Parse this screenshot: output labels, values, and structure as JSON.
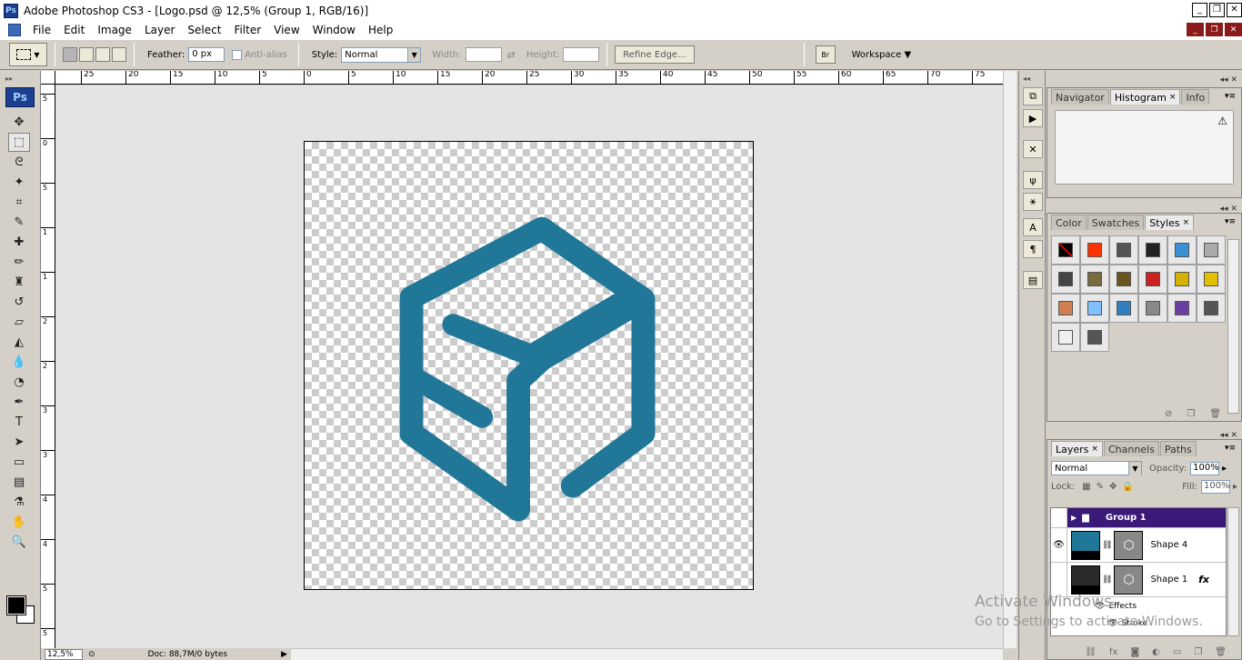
{
  "window": {
    "title": "Adobe Photoshop CS3 - [Logo.psd @ 12,5% (Group 1, RGB/16)]",
    "app_badge": "Ps",
    "controls": [
      "_",
      "❐",
      "✕"
    ],
    "doc_controls": [
      "_",
      "❐",
      "✕"
    ]
  },
  "menu": [
    "File",
    "Edit",
    "Image",
    "Layer",
    "Select",
    "Filter",
    "View",
    "Window",
    "Help"
  ],
  "options": {
    "feather_label": "Feather:",
    "feather_value": "0 px",
    "antialias_label": "Anti-alias",
    "style_label": "Style:",
    "style_value": "Normal",
    "width_label": "Width:",
    "height_label": "Height:",
    "refine_edge": "Refine Edge...",
    "bridge_label": "Br",
    "workspace_label": "Workspace"
  },
  "toolbox": {
    "logo": "Ps",
    "tools": [
      {
        "name": "move-tool",
        "glyph": "✥"
      },
      {
        "name": "rectangular-marquee-tool",
        "glyph": "⬚",
        "active": true
      },
      {
        "name": "lasso-tool",
        "glyph": "ᘓ"
      },
      {
        "name": "magic-wand-tool",
        "glyph": "✦"
      },
      {
        "name": "crop-tool",
        "glyph": "⌗"
      },
      {
        "name": "slice-tool",
        "glyph": "✎"
      },
      {
        "name": "healing-brush-tool",
        "glyph": "✚"
      },
      {
        "name": "brush-tool",
        "glyph": "✏"
      },
      {
        "name": "clone-stamp-tool",
        "glyph": "♜"
      },
      {
        "name": "history-brush-tool",
        "glyph": "↺"
      },
      {
        "name": "eraser-tool",
        "glyph": "▱"
      },
      {
        "name": "paint-bucket-tool",
        "glyph": "◭"
      },
      {
        "name": "blur-tool",
        "glyph": "💧"
      },
      {
        "name": "dodge-tool",
        "glyph": "◔"
      },
      {
        "name": "pen-tool",
        "glyph": "✒"
      },
      {
        "name": "type-tool",
        "glyph": "T"
      },
      {
        "name": "path-selection-tool",
        "glyph": "➤"
      },
      {
        "name": "rectangle-tool",
        "glyph": "▭"
      },
      {
        "name": "notes-tool",
        "glyph": "▤"
      },
      {
        "name": "eyedropper-tool",
        "glyph": "⚗"
      },
      {
        "name": "hand-tool",
        "glyph": "✋"
      },
      {
        "name": "zoom-tool",
        "glyph": "🔍"
      }
    ]
  },
  "rulers": {
    "h_labels": [
      "25",
      "20",
      "15",
      "10",
      "5",
      "0",
      "5",
      "10",
      "15",
      "20",
      "25",
      "30",
      "35",
      "40",
      "45",
      "50",
      "55",
      "60",
      "65",
      "70",
      "75"
    ],
    "v_labels": [
      "5",
      "0",
      "5",
      "1",
      "1",
      "2",
      "2",
      "3",
      "3",
      "4",
      "4",
      "5",
      "5",
      "6"
    ]
  },
  "canvas": {
    "logo_color": "#217798"
  },
  "status": {
    "zoom": "12,5%",
    "doc_info": "Doc: 88,7M/0 bytes"
  },
  "panels": {
    "nav_tabs": [
      {
        "label": "Navigator",
        "active": false
      },
      {
        "label": "Histogram",
        "active": true,
        "close": "×"
      },
      {
        "label": "Info",
        "active": false
      }
    ],
    "color_tabs": [
      {
        "label": "Color",
        "active": false
      },
      {
        "label": "Swatches",
        "active": false
      },
      {
        "label": "Styles",
        "active": true,
        "close": "×"
      }
    ],
    "styles": [
      "#000000",
      "#ff3300",
      "#555555",
      "#222222",
      "#3a8fd6",
      "#aaaaaa",
      "#444444",
      "#7a6a40",
      "#6a5520",
      "#cc2222",
      "#d4b000",
      "#e0c000",
      "#d08050",
      "#80c0ff",
      "#3080c0",
      "#888888",
      "#6a3fa0",
      "#555555",
      "#f0f0f0",
      "#555555"
    ],
    "layers_tabs": [
      {
        "label": "Layers",
        "active": true,
        "close": "×"
      },
      {
        "label": "Channels",
        "active": false
      },
      {
        "label": "Paths",
        "active": false
      }
    ],
    "blend_mode": "Normal",
    "opacity_label": "Opacity:",
    "opacity_value": "100%",
    "lock_label": "Lock:",
    "fill_label": "Fill:",
    "fill_value": "100%",
    "layers": [
      {
        "name": "Group 1",
        "type": "group"
      },
      {
        "name": "Shape 4",
        "type": "shape",
        "thumb": "#217798",
        "visible": true
      },
      {
        "name": "Shape 1",
        "type": "shape",
        "thumb": "#2a2a2a",
        "visible": false,
        "fx": "fx"
      }
    ],
    "effects_label": "Effects",
    "stroke_label": "Stroke"
  },
  "watermark": {
    "line1": "Activate Windows",
    "line2": "Go to Settings to activate Windows."
  }
}
